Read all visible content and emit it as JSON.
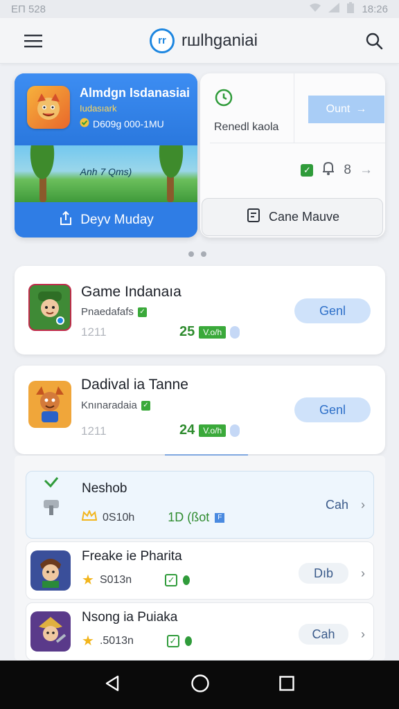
{
  "status_bar": {
    "left": "ЕП 528",
    "time": "18:26"
  },
  "app": {
    "title": "rшlhganiai",
    "logo_text": "rr"
  },
  "hero": {
    "title": "Almdgn Isdanasiai",
    "subtitle": "Iudasıark",
    "meta": "D609g 000-1MU",
    "scene_caption": "Anh 7 Qms)",
    "primary_button": "Deyv Muday",
    "status_label": "Renedl kaola",
    "go_button": "Ount",
    "counter": "8",
    "secondary_button": "Cane Mauve"
  },
  "featured_games": [
    {
      "title": "Game Indanaıa",
      "developer": "Pnaedafafs",
      "number": "1211",
      "score": "25",
      "tag": "V.o/h",
      "button": "Genl",
      "icon": "character-green-icon",
      "icon_bg": "#4a8f3a"
    },
    {
      "title": "Dadival ia Tanne",
      "developer": "Knınaradaia",
      "number": "1211",
      "score": "24",
      "tag": "V.o/h",
      "button": "Genl",
      "icon": "character-orange-icon",
      "icon_bg": "#e9a23b"
    }
  ],
  "list": [
    {
      "title": "Neshob",
      "meta": "0S10h",
      "extra": "1D (ßot",
      "action": "Cah",
      "icon": "hammer-icon"
    },
    {
      "title": "Freake ie Pharita",
      "meta": "S013n",
      "action": "Dıb",
      "icon": "character-hero-icon"
    },
    {
      "title": "Nsong ia Puiaka",
      "meta": ".5013n",
      "action": "Cah",
      "icon": "character-knight-icon"
    }
  ],
  "colors": {
    "accent": "#2f7de5",
    "light_accent": "#cfe2fa",
    "success": "#2f9b3a",
    "background": "#eef0f4"
  }
}
